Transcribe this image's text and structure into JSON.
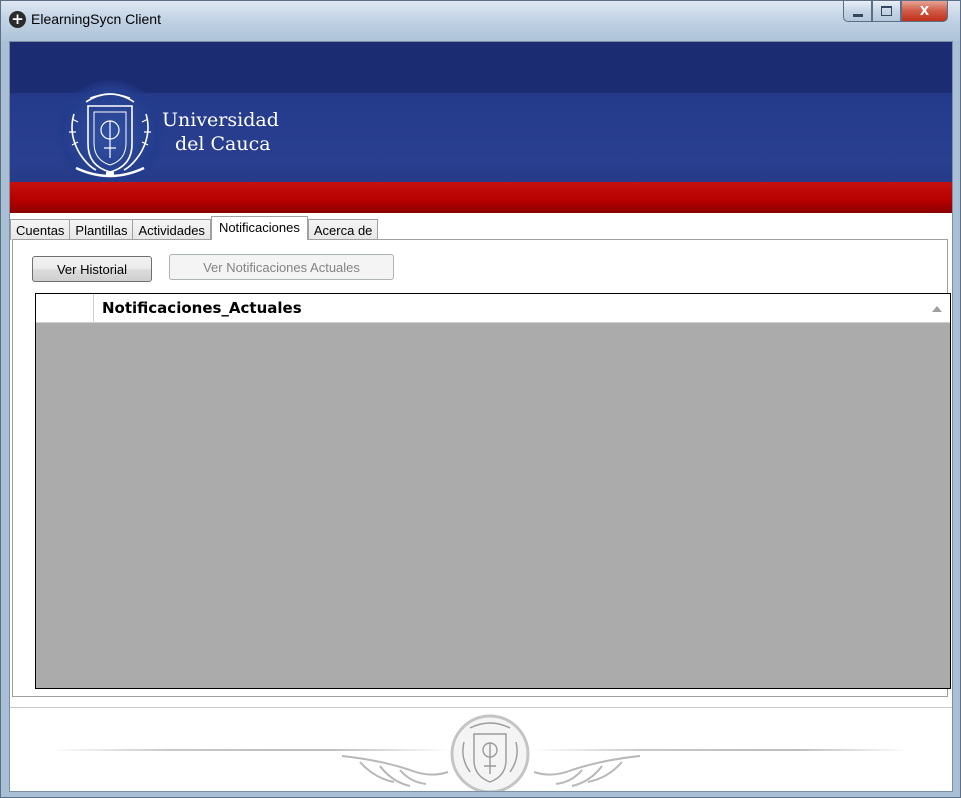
{
  "window": {
    "title": "ElearningSycn Client",
    "icon": "plus-circle-icon",
    "controls": {
      "minimize": "minimize-icon",
      "maximize": "maximize-icon",
      "close_label": "X"
    }
  },
  "banner": {
    "line1": "Universidad",
    "line2": "del Cauca",
    "colors": {
      "blue": "#243a8a",
      "red": "#b50000"
    }
  },
  "tabs": [
    {
      "label": "Cuentas",
      "active": false
    },
    {
      "label": "Plantillas",
      "active": false
    },
    {
      "label": "Actividades",
      "active": false
    },
    {
      "label": "Notificaciones",
      "active": true
    },
    {
      "label": "Acerca de",
      "active": false
    }
  ],
  "panel": {
    "ver_historial": "Ver Historial",
    "ver_notificaciones_actuales": "Ver Notificaciones Actuales",
    "grid": {
      "column_header": "Notificaciones_Actuales",
      "sort": "ascending",
      "rows": []
    }
  }
}
